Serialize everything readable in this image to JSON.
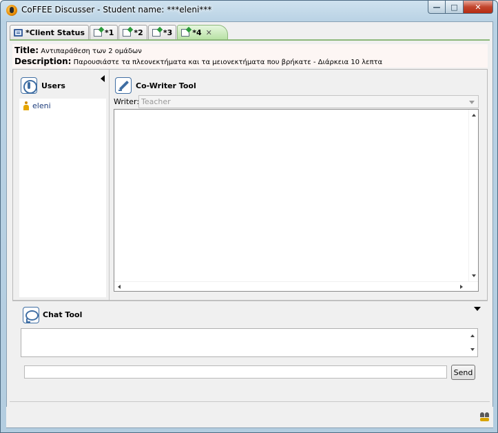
{
  "window": {
    "title": "CoFFEE Discusser - Student name: ***eleni***",
    "minimize_glyph": "—",
    "maximize_glyph": "□",
    "close_glyph": "✕"
  },
  "tabs": [
    {
      "label": "*Client Status",
      "icon": "monitor-icon"
    },
    {
      "label": "*1",
      "icon": "note-icon"
    },
    {
      "label": "*2",
      "icon": "note-icon"
    },
    {
      "label": "*3",
      "icon": "note-icon"
    },
    {
      "label": "*4",
      "icon": "note-icon",
      "active": true,
      "close_glyph": "✕"
    }
  ],
  "session": {
    "title_label": "Title:",
    "title_value": "Αντιπαράθεση των 2 ομάδων",
    "description_label": "Description:",
    "description_value": "Παρουσιάστε τα πλεονεκτήματα και τα μειονεκτήματα που βρήκατε - Διάρκεια 10 λεπτα"
  },
  "users_panel": {
    "title": "Users",
    "users": [
      {
        "name": "eleni"
      }
    ]
  },
  "cowriter": {
    "title": "Co-Writer Tool",
    "writer_label": "Writer:",
    "writer_value": "Teacher"
  },
  "chat": {
    "title": "Chat Tool",
    "input_value": "",
    "send_label": "Send"
  },
  "colors": {
    "active_tab": "#b6e0a2",
    "accent_blue": "#3f6ea3",
    "user_link": "#1a3a7a"
  }
}
